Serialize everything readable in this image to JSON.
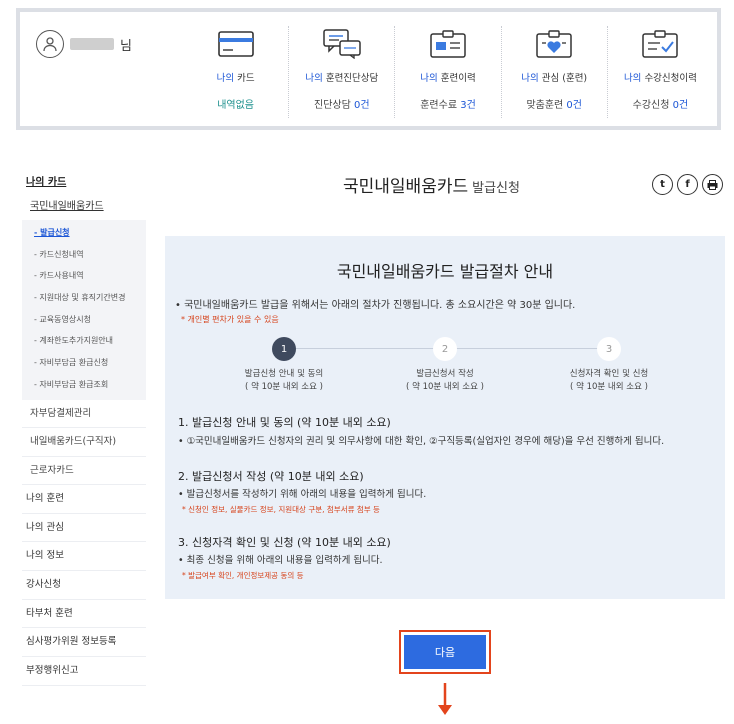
{
  "summary": {
    "user_suffix": "님",
    "columns": [
      {
        "label_hl": "나의 ",
        "label_rest": "카드",
        "value_plain": "내역없음",
        "value_num": ""
      },
      {
        "label_hl": "나의 ",
        "label_rest": "훈련진단상담",
        "value_plain": "진단상담 ",
        "value_num": "0건"
      },
      {
        "label_hl": "나의 ",
        "label_rest": "훈련이력",
        "value_plain": "훈련수료 ",
        "value_num": "3건"
      },
      {
        "label_hl": "나의 ",
        "label_rest": "관심 (훈련)",
        "value_plain": "맞춤훈련 ",
        "value_num": "0건"
      },
      {
        "label_hl": "나의 ",
        "label_rest": "수강신청이력",
        "value_plain": "수강신청 ",
        "value_num": "0건"
      }
    ]
  },
  "sidebar": {
    "title": "나의 카드",
    "sub_active": "국민내일배움카드",
    "subitems": [
      "- 발급신청",
      "- 카드신청내역",
      "- 카드사용내역",
      "- 지원대상 및 휴직기간변경",
      "- 교육동영상시청",
      "- 계좌한도추가지원안내",
      "- 자비부담금 환급신청",
      "- 자비부담금 환급조회"
    ],
    "mid_items": [
      "자부담결제관리",
      "내일배움카드(구직자)",
      "근로자카드"
    ],
    "top_items": [
      "나의 훈련",
      "나의 관심",
      "나의 정보",
      "강사신청",
      "타부처 훈련",
      "심사평가위원 정보등록",
      "부정행위신고"
    ]
  },
  "main": {
    "title": "국민내일배움카드",
    "title_sub": "발급신청",
    "share": {
      "twitter": "t",
      "facebook": "f",
      "print": "p"
    },
    "panel": {
      "title": "국민내일배움카드 발급절차 안내",
      "intro": "• 국민내일배움카드 발급을 위해서는 아래의 절차가 진행됩니다. 총 소요시간은 약 30분 입니다.",
      "intro_note": "* 개인별 편차가 있을 수 있음",
      "steps": [
        {
          "num": "1",
          "label": "발급신청 안내 및 동의",
          "time": "( 약 10분 내외 소요 )"
        },
        {
          "num": "2",
          "label": "발급신청서 작성",
          "time": "( 약 10분 내외 소요 )"
        },
        {
          "num": "3",
          "label": "신청자격 확인 및 신청",
          "time": "( 약 10분 내외 소요 )"
        }
      ],
      "sections": [
        {
          "title": "1. 발급신청 안내 및 동의 (약 10분 내외 소요)",
          "desc": "• ①국민내일배움카드 신청자의 권리 및 의무사항에 대한 확인, ②구직등록(실업자인 경우에 해당)을 우선 진행하게 됩니다.",
          "note": ""
        },
        {
          "title": "2. 발급신청서 작성 (약 10분 내외 소요)",
          "desc": "• 발급신청서를 작성하기 위해 아래의 내용을 입력하게 됩니다.",
          "note": "* 신청인 정보, 실물카드 정보, 지원대상 구분, 첨부서류 첨부 등"
        },
        {
          "title": "3. 신청자격 확인 및 신청 (약 10분 내외 소요)",
          "desc": "• 최종 신청을 위해 아래의 내용을 입력하게 됩니다.",
          "note": "* 발급여부 확인, 개인정보제공 동의 등"
        }
      ]
    },
    "next_label": "다음"
  }
}
